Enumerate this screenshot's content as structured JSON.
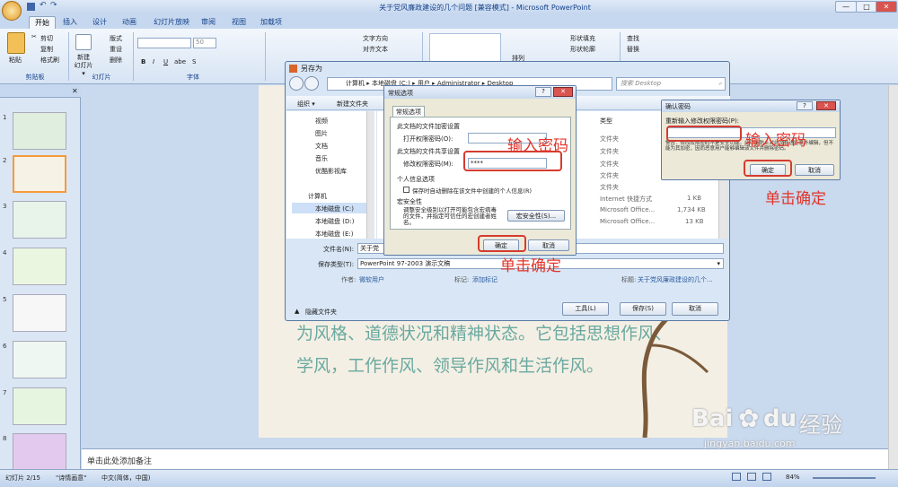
{
  "window": {
    "title": "关于党风廉政建设的几个问题 [兼容模式] - Microsoft PowerPoint",
    "minimize": "—",
    "maximize": "□",
    "close": "✕"
  },
  "ribbon": {
    "tabs": [
      "开始",
      "插入",
      "设计",
      "动画",
      "幻灯片放映",
      "审阅",
      "视图",
      "加载项"
    ],
    "clipboard": {
      "paste": "粘贴",
      "cut": "剪切",
      "copy": "复制",
      "format_painter": "格式刷",
      "label": "剪贴板"
    },
    "slides": {
      "new_slide": "新建\n幻灯片",
      "layout": "版式",
      "reset": "重设",
      "delete": "删除",
      "label": "幻灯片"
    },
    "font": {
      "size": "50",
      "label": "字体"
    },
    "paragraph": {
      "text_direction": "文字方向",
      "align_text": "对齐文本"
    },
    "drawing": {
      "shape_fill": "形状填充",
      "shape_outline": "形状轮廓",
      "arrange": "排列",
      "quick_styles": "快速样式"
    },
    "editing": {
      "find": "查找",
      "replace": "替换"
    }
  },
  "slides_panel": {
    "numbers": [
      "1",
      "2",
      "3",
      "4",
      "5",
      "6",
      "7",
      "8"
    ]
  },
  "save_as": {
    "title": "另存为",
    "breadcrumb": [
      "计算机",
      "本地磁盘 (C:)",
      "用户",
      "Administrator",
      "Desktop"
    ],
    "search_placeholder": "搜索 Desktop",
    "toolbar": {
      "organize": "组织 ▾",
      "new_folder": "新建文件夹"
    },
    "nav_items": [
      "视频",
      "图片",
      "文档",
      "音乐",
      "优酷影视库",
      "计算机",
      "本地磁盘 (C:)",
      "本地磁盘 (D:)",
      "本地磁盘 (E:)"
    ],
    "columns": {
      "type": "类型"
    },
    "files": [
      {
        "type": "文件夹",
        "size": ""
      },
      {
        "type": "文件夹",
        "size": ""
      },
      {
        "type": "文件夹",
        "size": ""
      },
      {
        "type": "文件夹",
        "size": ""
      },
      {
        "type": "文件夹",
        "size": ""
      },
      {
        "type": "Internet 快捷方式",
        "size": "1 KB"
      },
      {
        "type": "Microsoft Office...",
        "size": "1,734 KB"
      },
      {
        "type": "Microsoft Office...",
        "size": "13 KB"
      }
    ],
    "filename_label": "文件名(N):",
    "filename_value": "关于党",
    "savetype_label": "保存类型(T):",
    "savetype_value": "PowerPoint 97-2003 演示文稿",
    "author_label": "作者:",
    "author_value": "微软用户",
    "tags_label": "标记:",
    "tags_value": "添加标记",
    "title_label": "标题:",
    "title_value": "关于党风廉政建设的几个...",
    "hide_folders": "隐藏文件夹",
    "tools": "工具(L)",
    "save": "保存(S)",
    "cancel": "取消"
  },
  "options": {
    "title": "常规选项",
    "tab": "常规选项",
    "open_section": "此文档的文件加密设置",
    "open_label": "打开权限密码(O):",
    "share_section": "此文档的文件共享设置",
    "modify_label": "修改权限密码(M):",
    "modify_value": "****",
    "privacy_section": "个人信息选项",
    "privacy_check": "保存时自动删除在该文件中创建的个人信息(R)",
    "macro_section": "宏安全性",
    "macro_text": "调整安全级别以打开可能包含宏病毒的文件，并指定可信任的宏创建者姓名。",
    "macro_button": "宏安全性(S)...",
    "ok": "确定",
    "cancel": "取消"
  },
  "confirm": {
    "title": "确认密码",
    "prompt": "重新输入修改权限密码(P):",
    "warning": "警告：修改权限密码不是安全功能。此功能防止对此文档进行意外编辑，但不能为其加密，因而恶意用户能够编辑该文件并删除密码。",
    "ok": "确定",
    "cancel": "取消"
  },
  "annotations": {
    "enter_password_1": "输入密码",
    "click_ok_1": "单击确定",
    "enter_password_2": "输入密码",
    "click_ok_2": "单击确定"
  },
  "slide": {
    "line1": "为风格、道德状况和精神状态。它包括思想作风、",
    "line2": "学风，工作作风、领导作风和生活作风。"
  },
  "notes": {
    "placeholder": "单击此处添加备注"
  },
  "status": {
    "slide": "幻灯片 2/15",
    "theme": "\"诗情画意\"",
    "language": "中文(简体，中国)",
    "zoom": "84%"
  },
  "watermark": {
    "brand": "Bai",
    "brand2": "du",
    "cn": "经验",
    "url": "jingyan.baidu.com"
  },
  "colors": {
    "ribbon_bg": "#dbe6f4",
    "accent_red": "#e2352a",
    "slide_text": "#6aa9a0"
  }
}
